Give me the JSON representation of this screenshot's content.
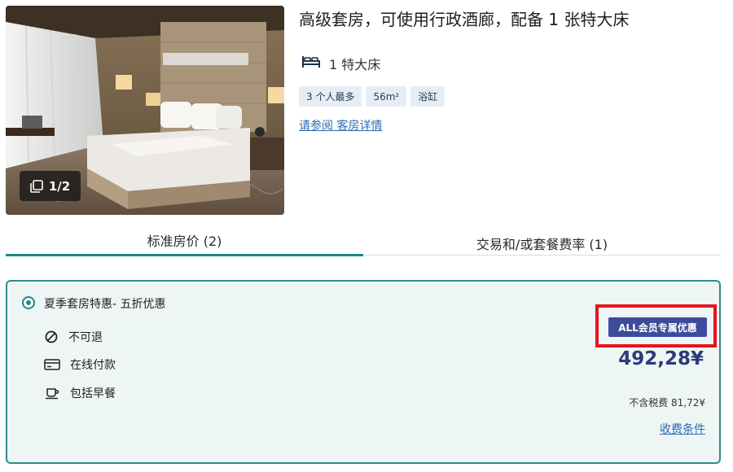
{
  "room": {
    "title": "高级套房，可使用行政酒廊，配备 1 张特大床",
    "bed_icon": "bed-icon",
    "bed": "1 特大床",
    "chips": [
      "3 个人最多",
      "56m²",
      "浴缸"
    ],
    "details_link": "请参阅 客房详情",
    "photo_counter": "1/2",
    "gallery_icon": "gallery-icon"
  },
  "tabs": [
    {
      "label": "标准房价 (2)",
      "active": true
    },
    {
      "label": "交易和/或套餐费率 (1)",
      "active": false
    }
  ],
  "rate": {
    "name": "夏季套房特惠- 五折优惠",
    "features": [
      {
        "icon": "no-refund-icon",
        "label": "不可退"
      },
      {
        "icon": "credit-card-icon",
        "label": "在线付款"
      },
      {
        "icon": "coffee-cup-icon",
        "label": "包括早餐"
      }
    ],
    "badge": "ALL会员专属优惠",
    "price": "492,28¥",
    "tax": "不含税费 81,72¥",
    "terms_link": "收费条件"
  },
  "colors": {
    "accent": "#1d8a87",
    "price": "#2c3a7a",
    "badge_bg": "#3c4c9b",
    "highlight_border": "#e5141d",
    "link": "#2f6ab0"
  }
}
